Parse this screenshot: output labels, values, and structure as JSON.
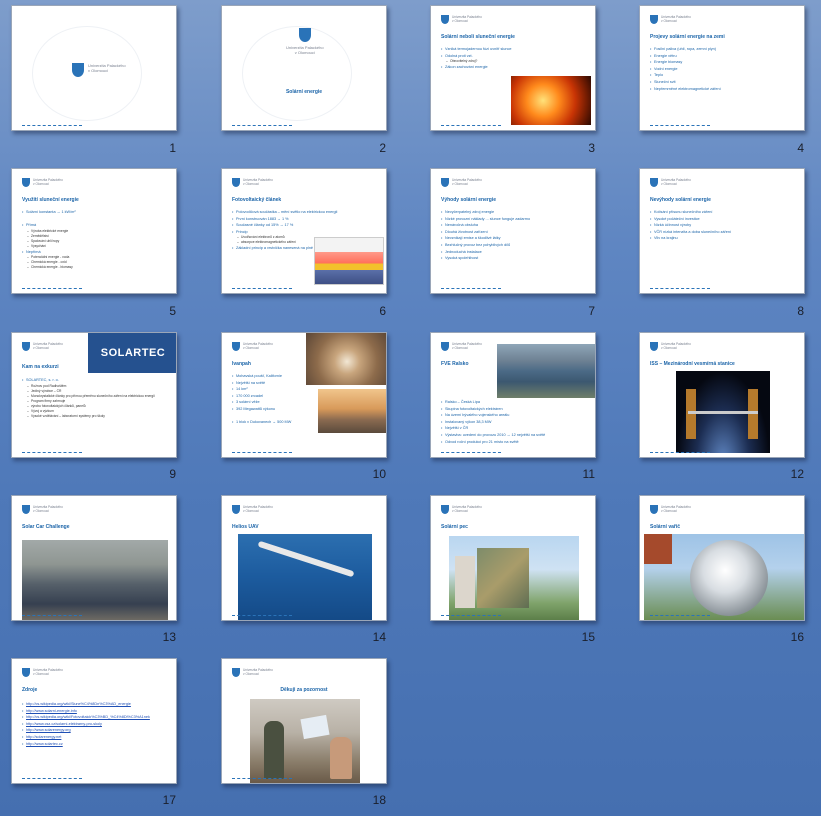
{
  "institution_line1": "Univerzita Palackého",
  "institution_line2": "v Olomouci",
  "slides": [
    {
      "num": "1"
    },
    {
      "num": "2",
      "title": "Solární energie"
    },
    {
      "num": "3",
      "title": "Solární neboli sluneční energie",
      "bullets": [
        "Vzniká termojadernou fúzí uvnitř slunce",
        "Odolná proti vzt.",
        "Obnovitelný zdroj?",
        "Zákon zachování energie"
      ]
    },
    {
      "num": "4",
      "title": "Projevy solární energie na zemi",
      "bullets": [
        "Fosilní paliva (uhlí, ropa, zemní plyn)",
        "Energie větru",
        "Energie biomasy",
        "Vodní energie",
        "Teplo",
        "Sluneční svit",
        "Nepřemrněné elektromagnetické záření"
      ]
    },
    {
      "num": "5",
      "title": "Využití sluneční energie",
      "bullets": [
        "Solární konstanta → 1 kW/m²",
        "",
        "Přímá",
        "Výroba elektrické energie",
        "Zemědělství",
        "Spalování uhlí/ropy",
        "Vysychání",
        "Nepřímá",
        "Potenciální energie - voda",
        "Chemická energie - oxid",
        "Chemická energie - biomasy"
      ]
    },
    {
      "num": "6",
      "title": "Fotovoltaický článek",
      "bullets": [
        "Polovodičová součástka – mění světlo na elektrickou energii",
        "První konstruován 1883 → 1 %",
        "Současné články od 15% → 17 %",
        "Princip",
        "Uvolňování elektronů z atomů",
        "absorpce elektromagnetického záření",
        "Základní princip a vrstvička nanesená na plně sklo"
      ]
    },
    {
      "num": "7",
      "title": "Výhody solární energie",
      "bullets": [
        "Nevyčerpatelný zdroj energie",
        "Nízké provozní náklady ... slunce funguje zadarmo",
        "Nenáročná obsluha",
        "Dlouhá životnost zařízení",
        "Nevznikají emise a škodlivé látky",
        "Bezhlučný provoz bez pohyblivých dílů",
        "Jednoduchá instalace",
        "Vysoká spolehlivost"
      ]
    },
    {
      "num": "8",
      "title": "Nevýhody solární energie",
      "bullets": [
        "Kolísání přísunu slunečního záření",
        "Vysoké počáteční investice",
        "Nízká účinnost výroby",
        "VČR nízká intenzita a doba slunečního záření",
        "Vliv na krajinu"
      ]
    },
    {
      "num": "9",
      "title": "Kam na exkurzi",
      "logo_text": "SOLARTEC",
      "bullets": [
        "SOLARTEC, s. r. o.",
        "Rožnov pod Radhoštěm",
        "Jediný výrobce – ČR",
        "Monokrystalické články pro přímou přeměnu slunečního záření na elektrickou energii",
        "Program firmy zahrnuje",
        "výrobu fotovoltaických článků, panelů",
        "Vývoj a výzkum",
        "Vysoké vzdělávání – laboratorní systémy pro školy"
      ]
    },
    {
      "num": "10",
      "title": "Ivanpah",
      "bullets": [
        "Mohavská poušť, Kalifornie",
        "Největší na světě",
        "14 km²",
        "170 000 zrcadel",
        "3 solární věže",
        "392 Megawattů výkonu",
        "",
        "1 blok v Dukovanech → 500 MW"
      ]
    },
    {
      "num": "11",
      "title": "FVE Ralsko",
      "bullets": [
        "Ralsko – Česká Lípa",
        "Skupina fotovoltaických elektráren",
        "Na území bývalého vojenského areálu",
        "Instalovaný výkon 38,3 MW",
        "Největší v ČR",
        "Výstavba: uvedení do provozu 2010 → 12 největší na světě",
        "Odvod roční produkci pro 21 místo na světě"
      ]
    },
    {
      "num": "12",
      "title": "ISS – Mezinárodní vesmírná stanice"
    },
    {
      "num": "13",
      "title": "Solar Car Challenge"
    },
    {
      "num": "14",
      "title": "Helios UAV"
    },
    {
      "num": "15",
      "title": "Solární pec"
    },
    {
      "num": "16",
      "title": "Solární vařič"
    },
    {
      "num": "17",
      "title": "Zdroje",
      "bullets": [
        "http://cs.wikipedia.org/wiki/Slune%C4%8Dn%C3%AD_energie",
        "http://www.solarni-energie.info",
        "http://cs.wikipedia.org/wiki/Fotovoltaick%C3%BD_%C4%8Dl%C3%A1nek",
        "http://www.csz.cz/solarni-elektrarny-pro-skoly",
        "http://www.solarenergy.org",
        "http://solarenergy.net",
        "http://www.solartec.cz"
      ]
    },
    {
      "num": "18",
      "title": "Děkuji za pozornost"
    }
  ],
  "colors": {
    "background": "#5f86c2",
    "slide_title": "#1b64a8",
    "bullet": "#1b64a8"
  }
}
